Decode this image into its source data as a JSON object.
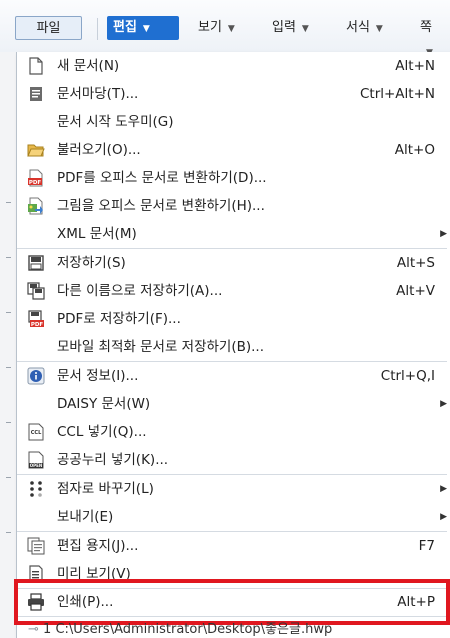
{
  "menubar": {
    "file_label": "파일",
    "edit_label": "편집",
    "view_label": "보기",
    "input_label": "입력",
    "format_label": "서식",
    "page_label": "쪽"
  },
  "dropdown": {
    "items": [
      {
        "label": "새 문서(N)",
        "shortcut": "Alt+N",
        "icon": "new-document-icon"
      },
      {
        "label": "문서마당(T)...",
        "shortcut": "Ctrl+Alt+N",
        "icon": "document-template-icon"
      },
      {
        "label": "문서 시작 도우미(G)",
        "shortcut": "",
        "icon": ""
      },
      {
        "label": "불러오기(O)...",
        "shortcut": "Alt+O",
        "icon": "open-folder-icon"
      },
      {
        "label": "PDF를 오피스 문서로 변환하기(D)...",
        "shortcut": "",
        "icon": "pdf-convert-icon"
      },
      {
        "label": "그림을 오피스 문서로 변환하기(H)...",
        "shortcut": "",
        "icon": "image-convert-icon"
      },
      {
        "label": "XML 문서(M)",
        "shortcut": "",
        "icon": ""
      },
      {
        "label": "저장하기(S)",
        "shortcut": "Alt+S",
        "icon": "save-icon"
      },
      {
        "label": "다른 이름으로 저장하기(A)...",
        "shortcut": "Alt+V",
        "icon": "save-as-icon"
      },
      {
        "label": "PDF로 저장하기(F)...",
        "shortcut": "",
        "icon": "save-pdf-icon"
      },
      {
        "label": "모바일 최적화 문서로 저장하기(B)...",
        "shortcut": "",
        "icon": ""
      },
      {
        "label": "문서 정보(I)...",
        "shortcut": "Ctrl+Q,I",
        "icon": "info-icon"
      },
      {
        "label": "DAISY 문서(W)",
        "shortcut": "",
        "icon": ""
      },
      {
        "label": "CCL 넣기(Q)...",
        "shortcut": "",
        "icon": "ccl-icon"
      },
      {
        "label": "공공누리 넣기(K)...",
        "shortcut": "",
        "icon": "open-license-icon"
      },
      {
        "label": "점자로 바꾸기(L)",
        "shortcut": "",
        "icon": "braille-icon"
      },
      {
        "label": "보내기(E)",
        "shortcut": "",
        "icon": ""
      },
      {
        "label": "편집 용지(J)...",
        "shortcut": "F7",
        "icon": "page-setup-icon"
      },
      {
        "label": "미리 보기(V)",
        "shortcut": "",
        "icon": "preview-icon"
      },
      {
        "label": "인쇄(P)...",
        "shortcut": "Alt+P",
        "icon": "print-icon"
      }
    ],
    "recent_file": "1 C:\\Users\\Administrator\\Desktop\\좋은글.hwp"
  },
  "colors": {
    "accent": "#1f6fd1",
    "highlight": "#e0171f"
  }
}
